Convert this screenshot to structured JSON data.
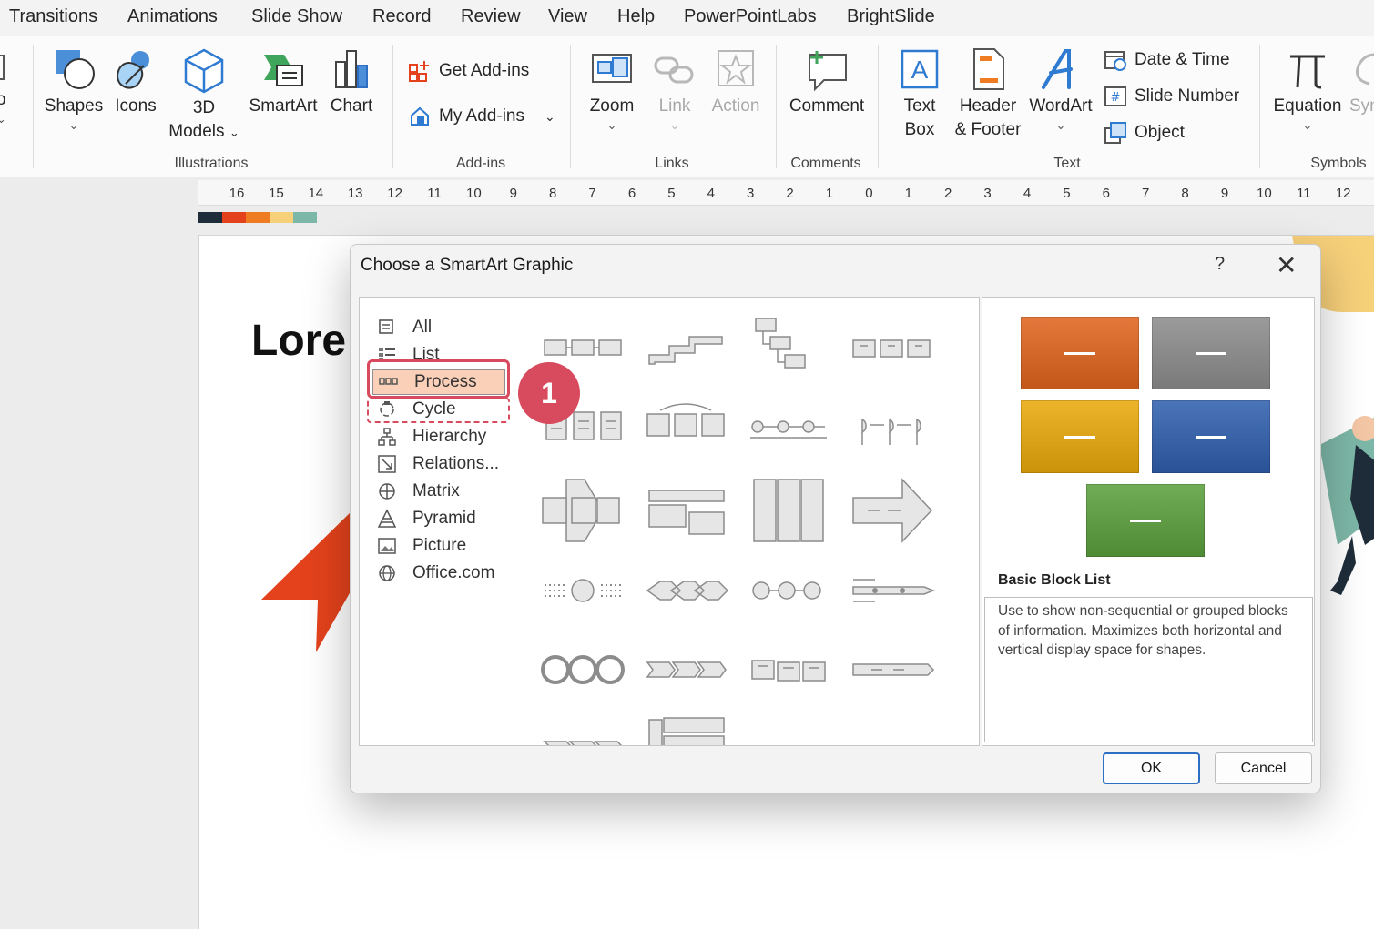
{
  "menu_tabs": [
    "Transitions",
    "Animations",
    "Slide Show",
    "Record",
    "Review",
    "View",
    "Help",
    "PowerPointLabs",
    "BrightSlide"
  ],
  "ribbon": {
    "edge_fragment": "o",
    "illustrations": {
      "label": "Illustrations",
      "shapes": "Shapes",
      "icons": "Icons",
      "models_1": "3D",
      "models_2": "Models",
      "smartart": "SmartArt",
      "chart": "Chart"
    },
    "addins": {
      "label": "Add-ins",
      "get": "Get Add-ins",
      "my": "My Add-ins"
    },
    "links": {
      "label": "Links",
      "zoom": "Zoom",
      "link": "Link",
      "action": "Action"
    },
    "comments": {
      "label": "Comments",
      "comment": "Comment"
    },
    "text": {
      "label": "Text",
      "textbox_1": "Text",
      "textbox_2": "Box",
      "header_1": "Header",
      "header_2": "& Footer",
      "wordart": "WordArt",
      "date_time": "Date & Time",
      "slide_number": "Slide Number",
      "object": "Object"
    },
    "symbols": {
      "label": "Symbols",
      "equation": "Equation",
      "symbol_fragment": "Syn"
    }
  },
  "ruler_ticks": [
    "16",
    "15",
    "14",
    "13",
    "12",
    "11",
    "10",
    "9",
    "8",
    "7",
    "6",
    "5",
    "4",
    "3",
    "2",
    "1",
    "0",
    "1",
    "2",
    "3",
    "4",
    "5",
    "6",
    "7",
    "8",
    "9",
    "10",
    "11",
    "12"
  ],
  "theme_colors": [
    "#1f2d3a",
    "#e3421c",
    "#ef7b22",
    "#f7d07a",
    "#7db7a7"
  ],
  "slide": {
    "title_fragment": "Lore"
  },
  "dialog": {
    "title": "Choose a SmartArt Graphic",
    "help": "?",
    "close": "✕",
    "categories": [
      {
        "label": "All",
        "icon": "all-icon"
      },
      {
        "label": "List",
        "icon": "list-icon"
      },
      {
        "label": "Process",
        "icon": "process-icon",
        "selected": true
      },
      {
        "label": "Cycle",
        "icon": "cycle-icon"
      },
      {
        "label": "Hierarchy",
        "icon": "hierarchy-icon"
      },
      {
        "label": "Relations...",
        "icon": "relationship-icon"
      },
      {
        "label": "Matrix",
        "icon": "matrix-icon"
      },
      {
        "label": "Pyramid",
        "icon": "pyramid-icon"
      },
      {
        "label": "Picture",
        "icon": "picture-icon"
      },
      {
        "label": "Office.com",
        "icon": "globe-icon"
      }
    ],
    "step_badge": "1",
    "preview": {
      "name": "Basic Block List",
      "description": "Use to show non-sequential or grouped blocks of information. Maximizes both horizontal and vertical display space for shapes.",
      "block_colors": [
        "#e0641e",
        "#8c8c8c",
        "#e9a90a",
        "#2f5fae",
        "#5aa03c"
      ]
    },
    "ok": "OK",
    "cancel": "Cancel"
  }
}
